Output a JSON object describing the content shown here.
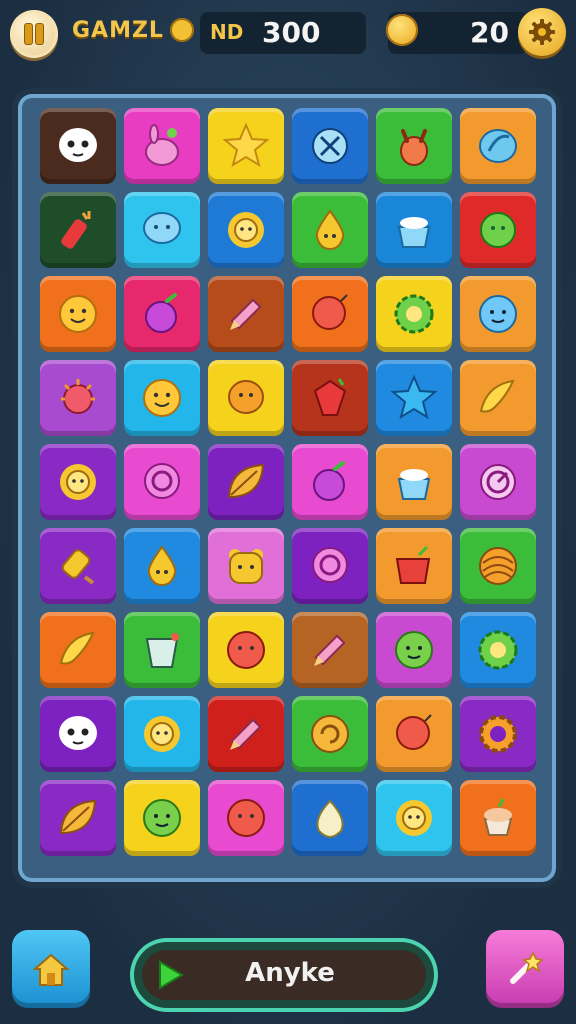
{
  "header": {
    "title": "GAMZL",
    "level_label": "ND",
    "score": "300",
    "coins": "20"
  },
  "footer": {
    "action_label": "Anyke"
  },
  "board": {
    "rows": 9,
    "cols": 6,
    "tiles": [
      [
        {
          "color": "#4a2b1e",
          "icon": "skull-face"
        },
        {
          "color": "#e83cc2",
          "icon": "bunny-blob"
        },
        {
          "color": "#f5d21c",
          "icon": "star"
        },
        {
          "color": "#1f6fd0",
          "icon": "bug-ball"
        },
        {
          "color": "#3cbd3a",
          "icon": "deer-head"
        },
        {
          "color": "#f29a2e",
          "icon": "leaf-bubble"
        }
      ],
      [
        {
          "color": "#1f4d2a",
          "icon": "candy-stick"
        },
        {
          "color": "#2fc4ee",
          "icon": "speech-blob"
        },
        {
          "color": "#1f7ad6",
          "icon": "sun-gear"
        },
        {
          "color": "#3cbd3a",
          "icon": "drop-face"
        },
        {
          "color": "#1a86d8",
          "icon": "sugar-bowl"
        },
        {
          "color": "#e02a2a",
          "icon": "green-bubble"
        }
      ],
      [
        {
          "color": "#f0701c",
          "icon": "smile-face"
        },
        {
          "color": "#e8286c",
          "icon": "purple-berry"
        },
        {
          "color": "#b64c1a",
          "icon": "pencil"
        },
        {
          "color": "#f0701c",
          "icon": "balloon"
        },
        {
          "color": "#f5d21c",
          "icon": "green-gear"
        },
        {
          "color": "#f29a2e",
          "icon": "blue-face"
        }
      ],
      [
        {
          "color": "#a94bd0",
          "icon": "spiky-berry"
        },
        {
          "color": "#22b6ea",
          "icon": "smile-face"
        },
        {
          "color": "#f5d21c",
          "icon": "orange-bubble"
        },
        {
          "color": "#b6341c",
          "icon": "red-gem"
        },
        {
          "color": "#1f8ae0",
          "icon": "blue-star"
        },
        {
          "color": "#f29a2e",
          "icon": "banana"
        }
      ],
      [
        {
          "color": "#8a2ac4",
          "icon": "sun-gear"
        },
        {
          "color": "#e84ad0",
          "icon": "ring-bubble"
        },
        {
          "color": "#7d22c0",
          "icon": "leaf"
        },
        {
          "color": "#e84ad0",
          "icon": "purple-berry"
        },
        {
          "color": "#f29a2e",
          "icon": "sugar-bowl"
        },
        {
          "color": "#c84ad0",
          "icon": "swirl-ring"
        }
      ],
      [
        {
          "color": "#8a2ac4",
          "icon": "popsicle"
        },
        {
          "color": "#1f8ae0",
          "icon": "drop-face"
        },
        {
          "color": "#e070d8",
          "icon": "bear-face"
        },
        {
          "color": "#7d22c0",
          "icon": "ring-bubble"
        },
        {
          "color": "#f29a2e",
          "icon": "red-cup"
        },
        {
          "color": "#3cbd3a",
          "icon": "yarn-ball"
        }
      ],
      [
        {
          "color": "#f0701c",
          "icon": "banana"
        },
        {
          "color": "#3cbd3a",
          "icon": "cup"
        },
        {
          "color": "#f5d21c",
          "icon": "red-face"
        },
        {
          "color": "#b66424",
          "icon": "pencil"
        },
        {
          "color": "#c84ad0",
          "icon": "green-face"
        },
        {
          "color": "#1f8ae0",
          "icon": "green-gear"
        }
      ],
      [
        {
          "color": "#7d22c0",
          "icon": "skull-face"
        },
        {
          "color": "#22b6ea",
          "icon": "sun-gear"
        },
        {
          "color": "#d0201c",
          "icon": "pencil"
        },
        {
          "color": "#3cbd3a",
          "icon": "orange-swirl"
        },
        {
          "color": "#f29a2e",
          "icon": "balloon"
        },
        {
          "color": "#8a2ac4",
          "icon": "orange-gear"
        }
      ],
      [
        {
          "color": "#8a2ac4",
          "icon": "leaf"
        },
        {
          "color": "#f5d21c",
          "icon": "green-face"
        },
        {
          "color": "#e84ad0",
          "icon": "red-face"
        },
        {
          "color": "#1f6fd0",
          "icon": "onion"
        },
        {
          "color": "#2fc4ee",
          "icon": "sun-gear"
        },
        {
          "color": "#f0701c",
          "icon": "cupcake"
        }
      ]
    ]
  }
}
